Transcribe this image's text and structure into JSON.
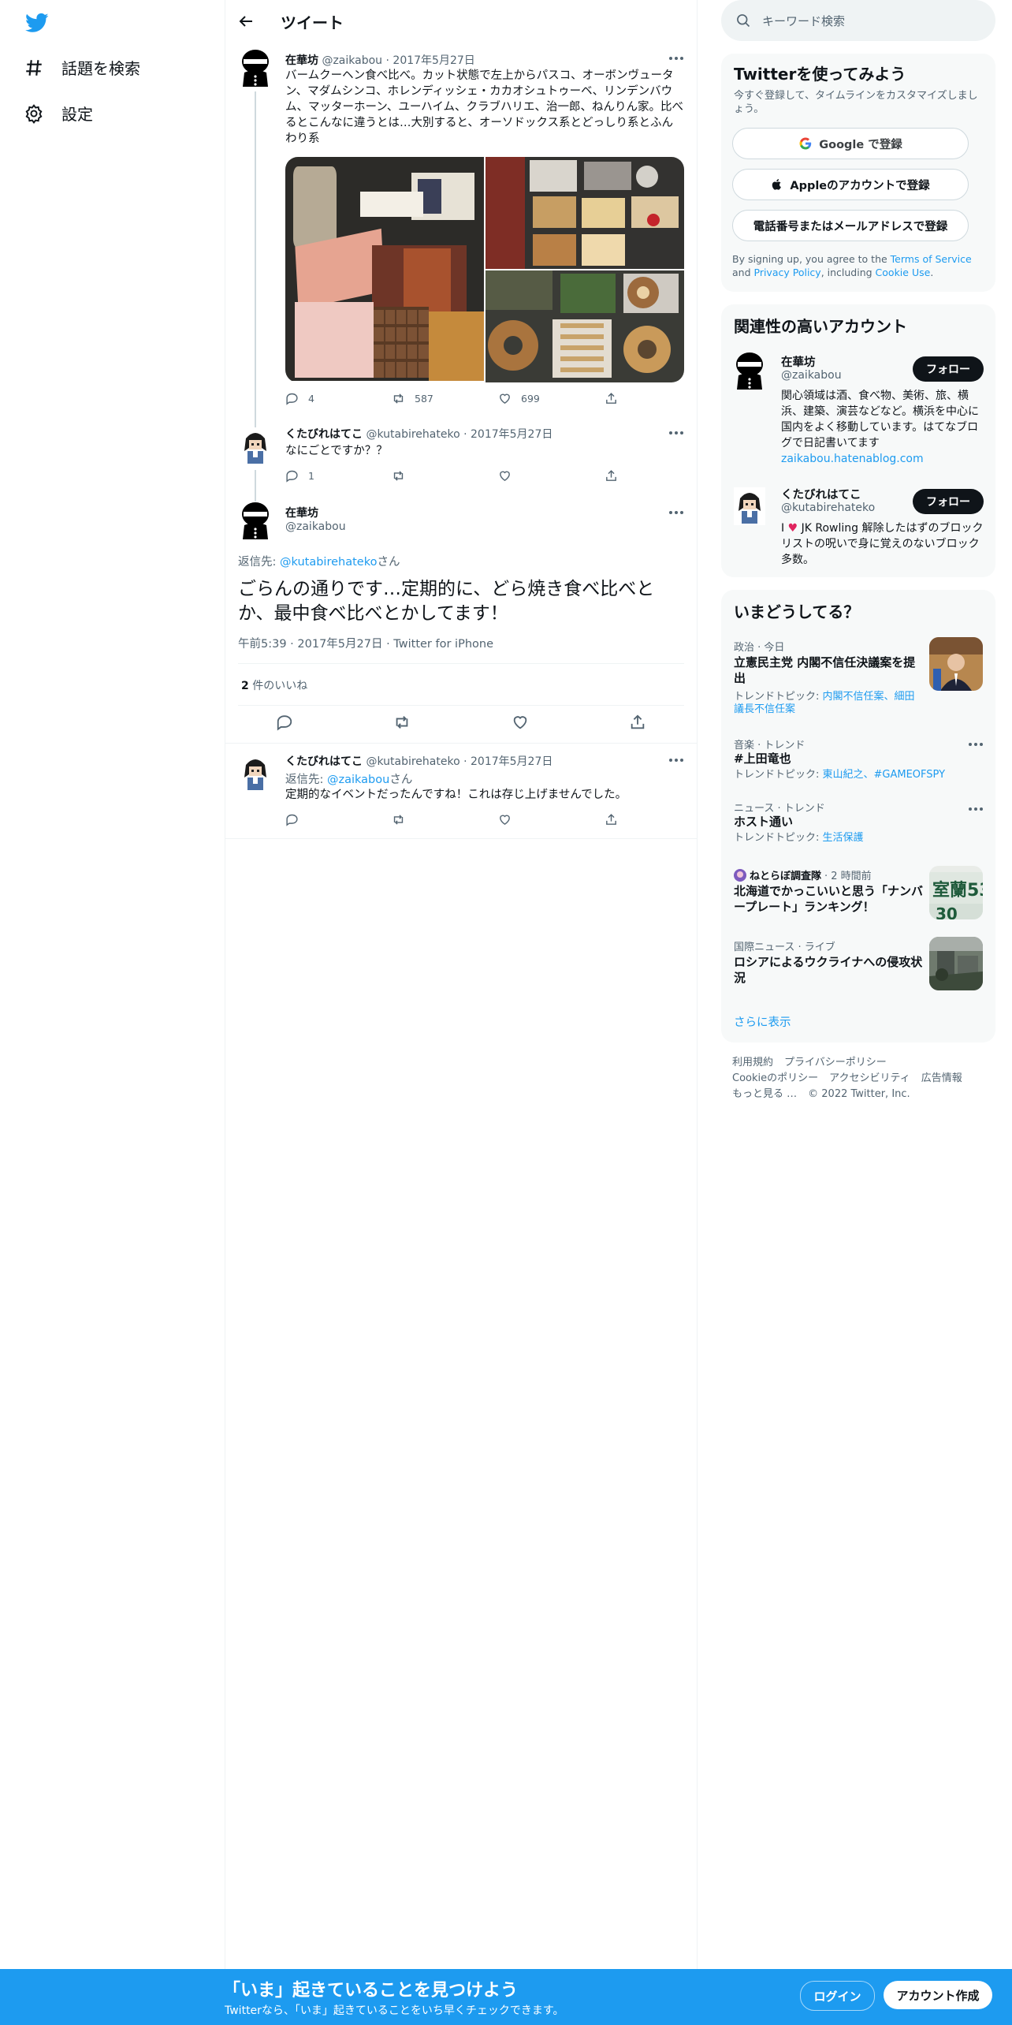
{
  "nav": {
    "logo_icon": "twitter-bird-icon",
    "explore_label": "話題を検索",
    "settings_label": "設定"
  },
  "header": {
    "title": "ツイート"
  },
  "tweet1": {
    "name": "在華坊",
    "handle": "@zaikabou",
    "date": "2017年5月27日",
    "text": "バームクーヘン食べ比べ。カット状態で左上からパスコ、オーボンヴュータン、マダムシンコ、ホレンディッシェ・カカオシュトゥーベ、リンデンバウム、マッターホーン、ユーハイム、クラブハリエ、治一郎、ねんりん家。比べるとこんなに違うとは…大別すると、オーソドックス系とどっしり系とふんわり系",
    "replies": "4",
    "retweets": "587",
    "likes": "699"
  },
  "tweet2": {
    "name": "くたびれはてこ",
    "handle": "@kutabirehateko",
    "date": "2017年5月27日",
    "text": "なにごとですか？？",
    "replies": "1"
  },
  "main_tweet": {
    "name": "在華坊",
    "handle": "@zaikabou",
    "reply_prefix": "返信先: ",
    "reply_to": "@kutabirehateko",
    "reply_suffix": "さん",
    "text": "ごらんの通りです…定期的に、どら焼き食べ比べとか、最中食べ比べとかしてます！",
    "timestamp": "午前5:39 · 2017年5月27日 · Twitter for iPhone",
    "likes_count": "2",
    "likes_label": " 件のいいね"
  },
  "tweet3": {
    "name": "くたびれはてこ",
    "handle": "@kutabirehateko",
    "date": "2017年5月27日",
    "reply_prefix": "返信先: ",
    "reply_to": "@zaikabou",
    "reply_suffix": "さん",
    "text": "定期的なイベントだったんですね！これは存じ上げませんでした。"
  },
  "search": {
    "placeholder": "キーワード検索"
  },
  "signup": {
    "title": "Twitterを使ってみよう",
    "subtitle": "今すぐ登録して、タイムラインをカスタマイズしましょう。",
    "google": "Google で登録",
    "apple": "Appleのアカウントで登録",
    "phone": "電話番号またはメールアドレスで登録",
    "legal_1": "By signing up, you agree to the ",
    "terms": "Terms of Service",
    "legal_2": " and ",
    "privacy": "Privacy Policy",
    "legal_3": ", including ",
    "cookie": "Cookie Use",
    "legal_4": "."
  },
  "related": {
    "title": "関連性の高いアカウント",
    "accounts": [
      {
        "name": "在華坊",
        "handle": "@zaikabou",
        "bio": "関心領域は酒、食べ物、美術、旅、横浜、建築、演芸などなど。横浜を中心に国内をよく移動しています。はてなブログで日記書いてます",
        "link": "zaikabou.hatenablog.com",
        "follow": "フォロー"
      },
      {
        "name": "くたびれはてこ",
        "handle": "@kutabirehateko",
        "bio_pre": "I ",
        "bio_post": " JK Rowling 解除したはずのブロックリストの呪いで身に覚えのないブロック多数。",
        "follow": "フォロー"
      }
    ]
  },
  "trends": {
    "title": "いまどうしてる？",
    "items": [
      {
        "category": "政治 · 今日",
        "title": "立憲民主党 内閣不信任決議案を提出",
        "sub_prefix": "トレンドトピック: ",
        "sub_links": "内閣不信任案、細田議長不信任案"
      },
      {
        "category": "音楽 · トレンド",
        "title": "#上田竜也",
        "sub_prefix": "トレンドトピック: ",
        "sub_links": "東山紀之、#GAMEOFSPY"
      },
      {
        "category": "ニュース · トレンド",
        "title": "ホスト通い",
        "sub_prefix": "トレンドトピック: ",
        "sub_links": "生活保護"
      },
      {
        "category_source": "ねとらぼ調査隊",
        "category_time": " · 2 時間前",
        "title": "北海道でかっこいいと思う「ナンバープレート」ランキング！"
      },
      {
        "category": "国際ニュース · ライブ",
        "title": "ロシアによるウクライナへの侵攻状況"
      }
    ],
    "show_more": "さらに表示"
  },
  "footer": {
    "terms": "利用規約",
    "privacy": "プライバシーポリシー",
    "cookie": "Cookieのポリシー",
    "accessibility": "アクセシビリティ",
    "ads": "広告情報",
    "more": "もっと見る …",
    "copyright": "© 2022 Twitter, Inc."
  },
  "bottombar": {
    "title": "「いま」起きていることを見つけよう",
    "subtitle": "Twitterなら、「いま」起きていることをいち早くチェックできます。",
    "login": "ログイン",
    "signup": "アカウント作成"
  },
  "colors": {
    "accent": "#1d9bf0",
    "text": "#0f1419",
    "muted": "#536471",
    "heart": "#e0245e"
  }
}
